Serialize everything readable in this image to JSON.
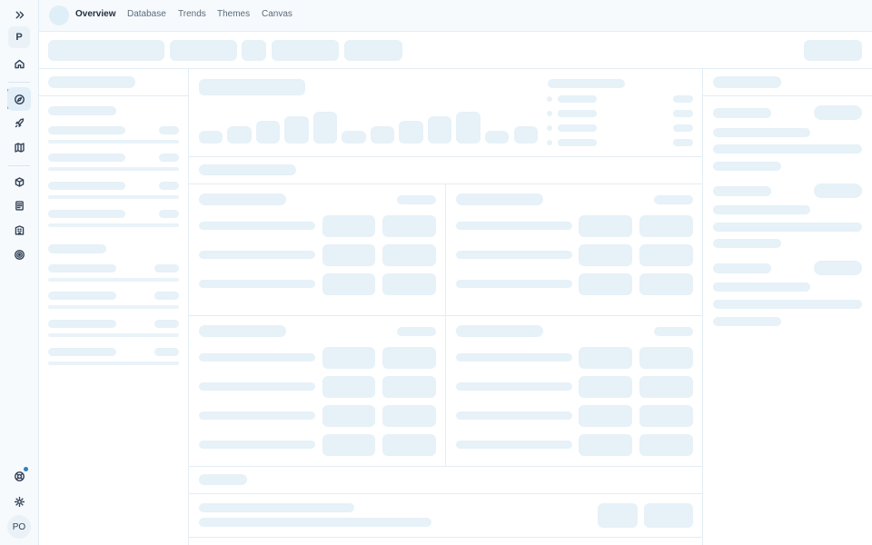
{
  "rail": {
    "workspace_initial": "P",
    "user_initials": "PO",
    "icons": [
      "expand-icon",
      "home-icon",
      "compass-icon",
      "rocket-icon",
      "map-icon",
      "cube-icon",
      "document-icon",
      "building-icon",
      "target-icon",
      "support-icon",
      "gear-icon"
    ],
    "accent_color": "#2f7fc0"
  },
  "nav": {
    "tabs": [
      {
        "label": "Overview",
        "active": true
      },
      {
        "label": "Database",
        "active": false
      },
      {
        "label": "Trends",
        "active": false
      },
      {
        "label": "Themes",
        "active": false
      },
      {
        "label": "Canvas",
        "active": false
      }
    ]
  },
  "state": {
    "loading": true,
    "skeleton_color": "#e6f1f8"
  }
}
